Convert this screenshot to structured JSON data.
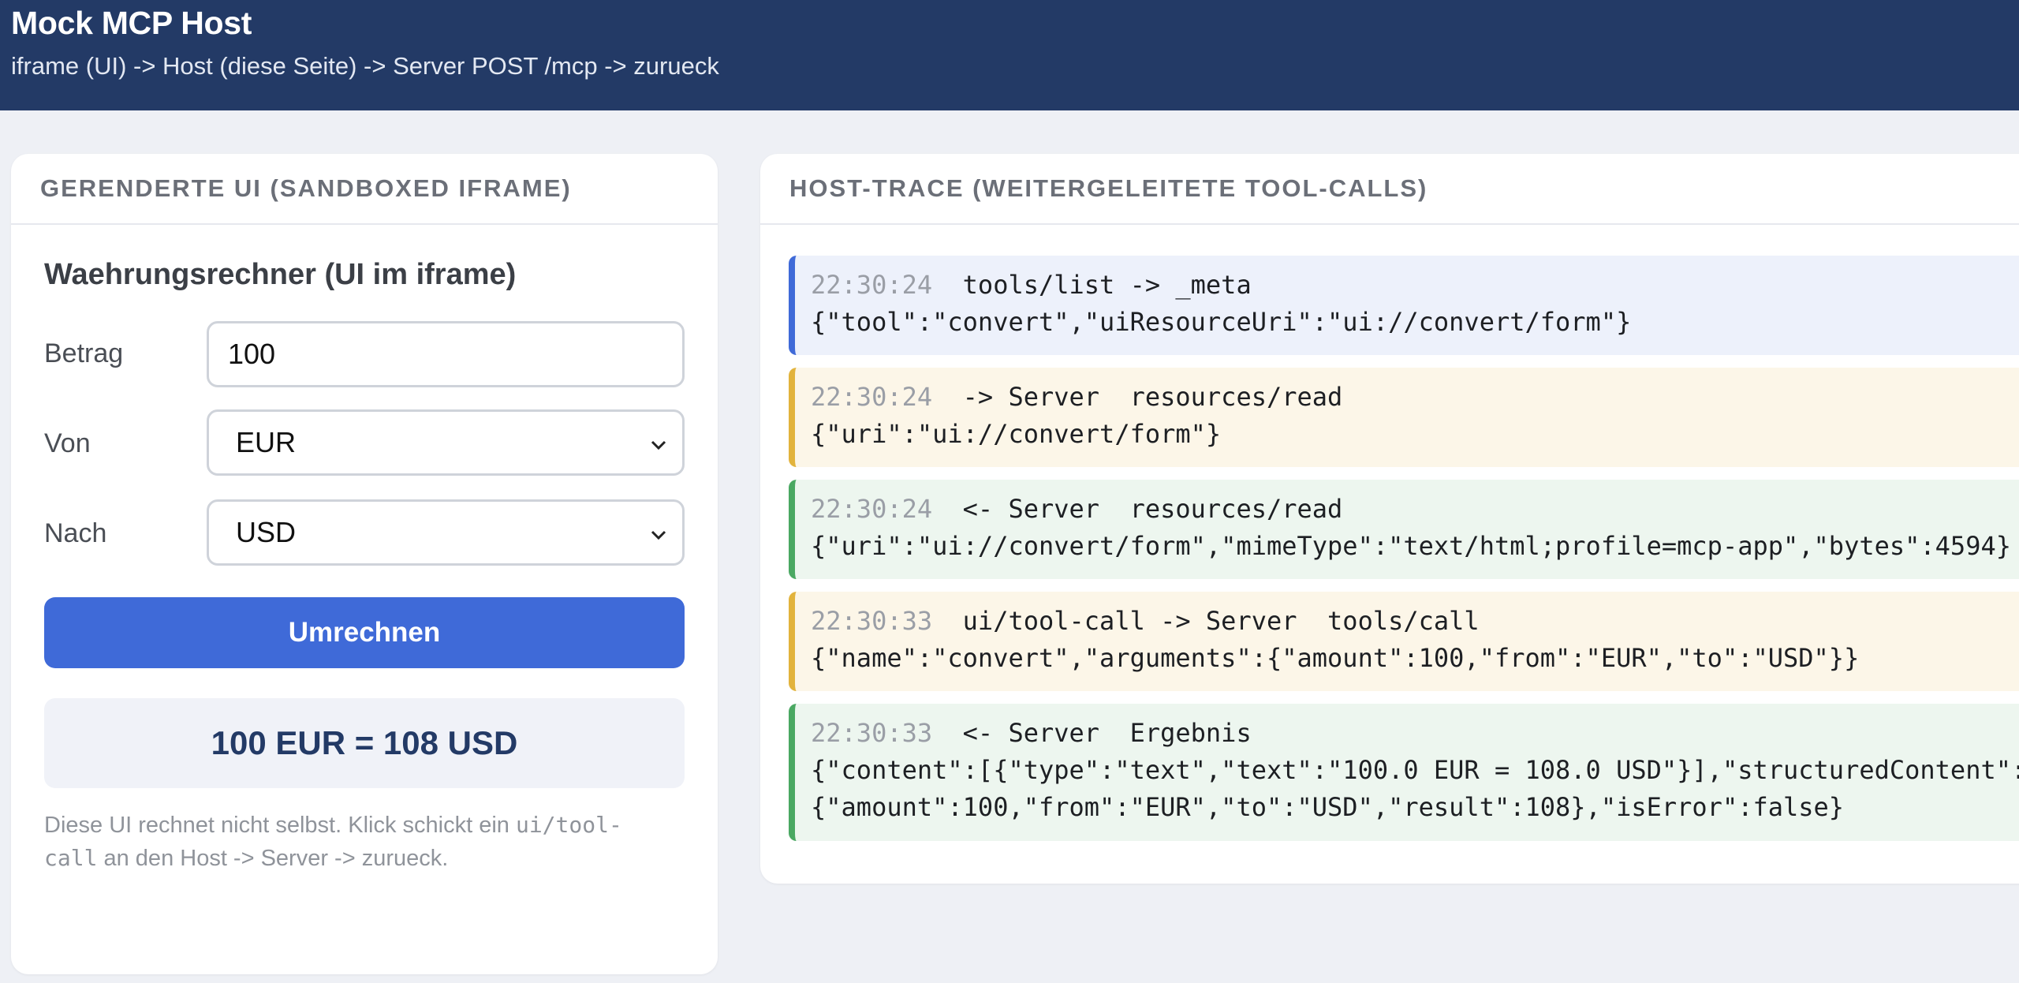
{
  "header": {
    "title": "Mock MCP Host",
    "subtitle": "iframe (UI) -> Host (diese Seite) -> Server POST /mcp -> zurueck"
  },
  "left_panel": {
    "heading": "GERENDERTE UI (SANDBOXED IFRAME)",
    "form_title": "Waehrungsrechner (UI im iframe)",
    "amount_label": "Betrag",
    "amount_value": "100",
    "from_label": "Von",
    "from_value": "EUR",
    "to_label": "Nach",
    "to_value": "USD",
    "convert_button": "Umrechnen",
    "result": "100 EUR = 108 USD",
    "note_part1": "Diese UI rechnet nicht selbst. Klick schickt ein ",
    "note_code1": "ui/tool-",
    "note_code2": "call",
    "note_part2": " an den Host -> Server -> zurueck."
  },
  "right_panel": {
    "heading": "HOST-TRACE (WEITERGELEITETE TOOL-CALLS)",
    "entries": [
      {
        "time": "22:30:24",
        "event": "tools/list -> _meta",
        "payload": "{\"tool\":\"convert\",\"uiResourceUri\":\"ui://convert/form\"}",
        "color": "#3f6ad8"
      },
      {
        "time": "22:30:24",
        "event": "-> Server  resources/read",
        "payload": "{\"uri\":\"ui://convert/form\"}",
        "color": "#e2b33c"
      },
      {
        "time": "22:30:24",
        "event": "<- Server  resources/read",
        "payload": "{\"uri\":\"ui://convert/form\",\"mimeType\":\"text/html;profile=mcp-app\",\"bytes\":4594}",
        "color": "#4aa862"
      },
      {
        "time": "22:30:33",
        "event": "ui/tool-call -> Server  tools/call",
        "payload": "{\"name\":\"convert\",\"arguments\":{\"amount\":100,\"from\":\"EUR\",\"to\":\"USD\"}}",
        "color": "#e2b33c"
      },
      {
        "time": "22:30:33",
        "event": "<- Server  Ergebnis",
        "payload": "{\"content\":[{\"type\":\"text\",\"text\":\"100.0 EUR = 108.0 USD\"}],\"structuredContent\":",
        "payload2": "{\"amount\":100,\"from\":\"EUR\",\"to\":\"USD\",\"result\":108},\"isError\":false}",
        "color": "#4aa862"
      }
    ]
  },
  "icons": {
    "select_chevron": "chevron-down-icon"
  }
}
